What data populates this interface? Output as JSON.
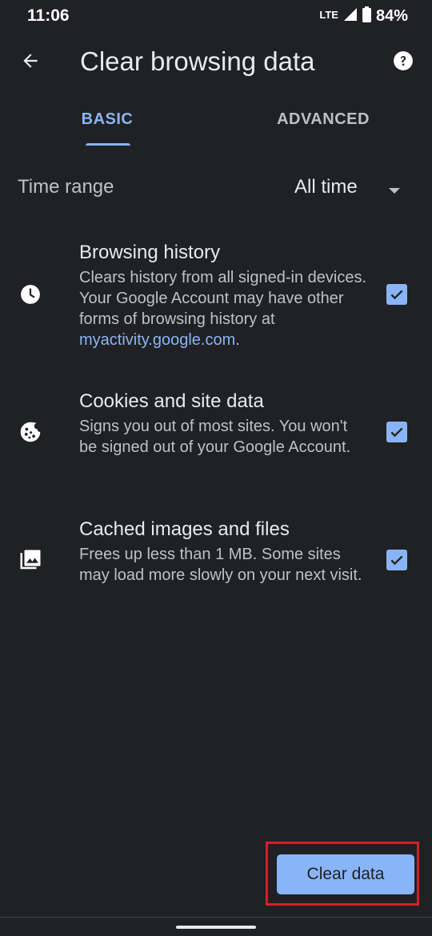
{
  "status_bar": {
    "time": "11:06",
    "network": "LTE",
    "battery": "84%"
  },
  "app_bar": {
    "title": "Clear browsing data",
    "back_icon": "arrow-back-icon",
    "help_icon": "help-icon"
  },
  "tabs": [
    {
      "label": "BASIC",
      "selected": true
    },
    {
      "label": "ADVANCED",
      "selected": false
    }
  ],
  "time_range": {
    "label": "Time range",
    "value": "All time"
  },
  "options": [
    {
      "title": "Browsing history",
      "desc_before": "Clears history from all signed-in devices. Your Google Account may have other forms of browsing history at ",
      "link": "myactivity.google.com",
      "desc_after": ".",
      "icon": "clock-icon",
      "checked": true
    },
    {
      "title": "Cookies and site data",
      "desc": "Signs you out of most sites. You won't be signed out of your Google Account.",
      "icon": "cookie-icon",
      "checked": true
    },
    {
      "title": "Cached images and files",
      "desc": "Frees up less than 1 MB. Some sites may load more slowly on your next visit.",
      "icon": "image-icon",
      "checked": true
    }
  ],
  "clear_button": {
    "label": "Clear data"
  },
  "colors": {
    "background": "#202124",
    "accent": "#8ab4f8",
    "highlight": "#d3202a"
  }
}
